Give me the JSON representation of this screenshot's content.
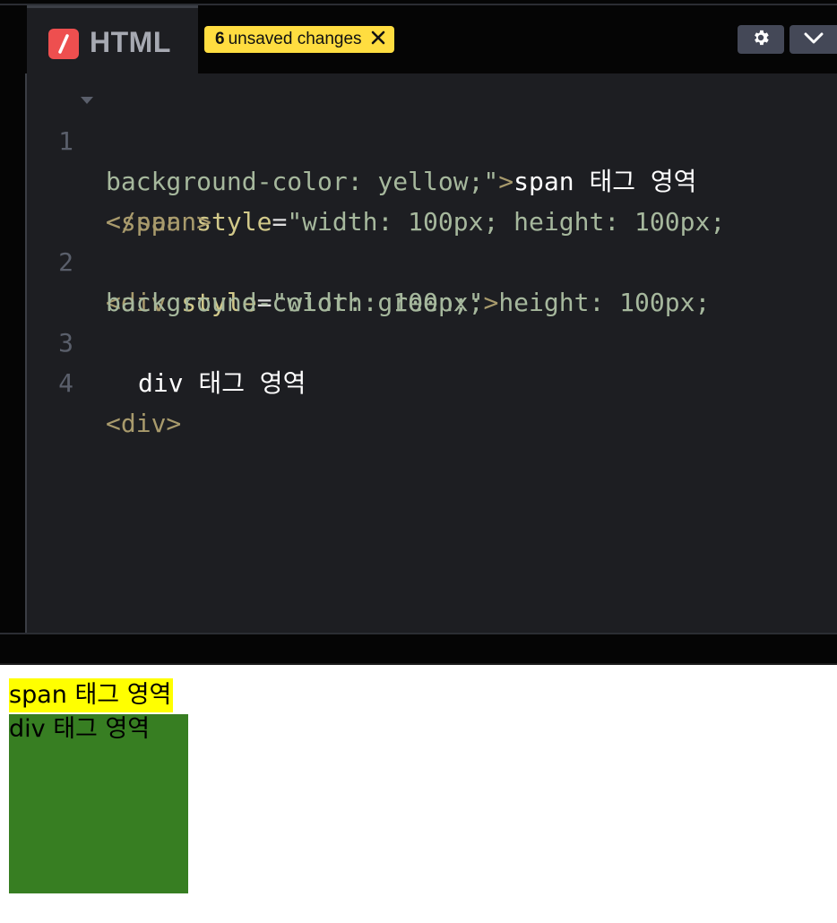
{
  "editor": {
    "tab_title": "HTML",
    "unsaved_count": "6",
    "unsaved_label": "unsaved changes",
    "lines": [
      {
        "num": "1"
      },
      {
        "num": "2"
      },
      {
        "num": "3"
      },
      {
        "num": "4"
      }
    ],
    "code": {
      "l1a_open": "<span",
      "l1a_attr": "style",
      "l1a_eq": "=",
      "l1a_str": "\"width: 100px; height: 100px;",
      "l1b_str": "background-color: yellow;\"",
      "l1b_close": ">",
      "l1b_text": "span 태그 영역",
      "l1c_end": "</span>",
      "l2a_open": "<div",
      "l2a_attr": "style",
      "l2a_eq": "=",
      "l2a_str": "\"width: 100px; height: 100px;",
      "l2b_str": "background-color: green;\"",
      "l2b_close": ">",
      "l3_text": "div 태그 영역",
      "l4_tag": "<div>"
    },
    "icons": {
      "logo": "codepen-slash-icon",
      "dismiss": "close-icon",
      "settings": "gear-icon",
      "collapse": "chevron-down-icon",
      "fold": "fold-triangle-icon"
    },
    "colors": {
      "badge": "#ffdd40",
      "logo": "#ee4f4f",
      "editor_bg": "#1d1e22"
    }
  },
  "preview": {
    "span_text": "span 태그 영역",
    "div_text": "div 태그 영역",
    "span_bg": "yellow",
    "div_bg": "green"
  }
}
